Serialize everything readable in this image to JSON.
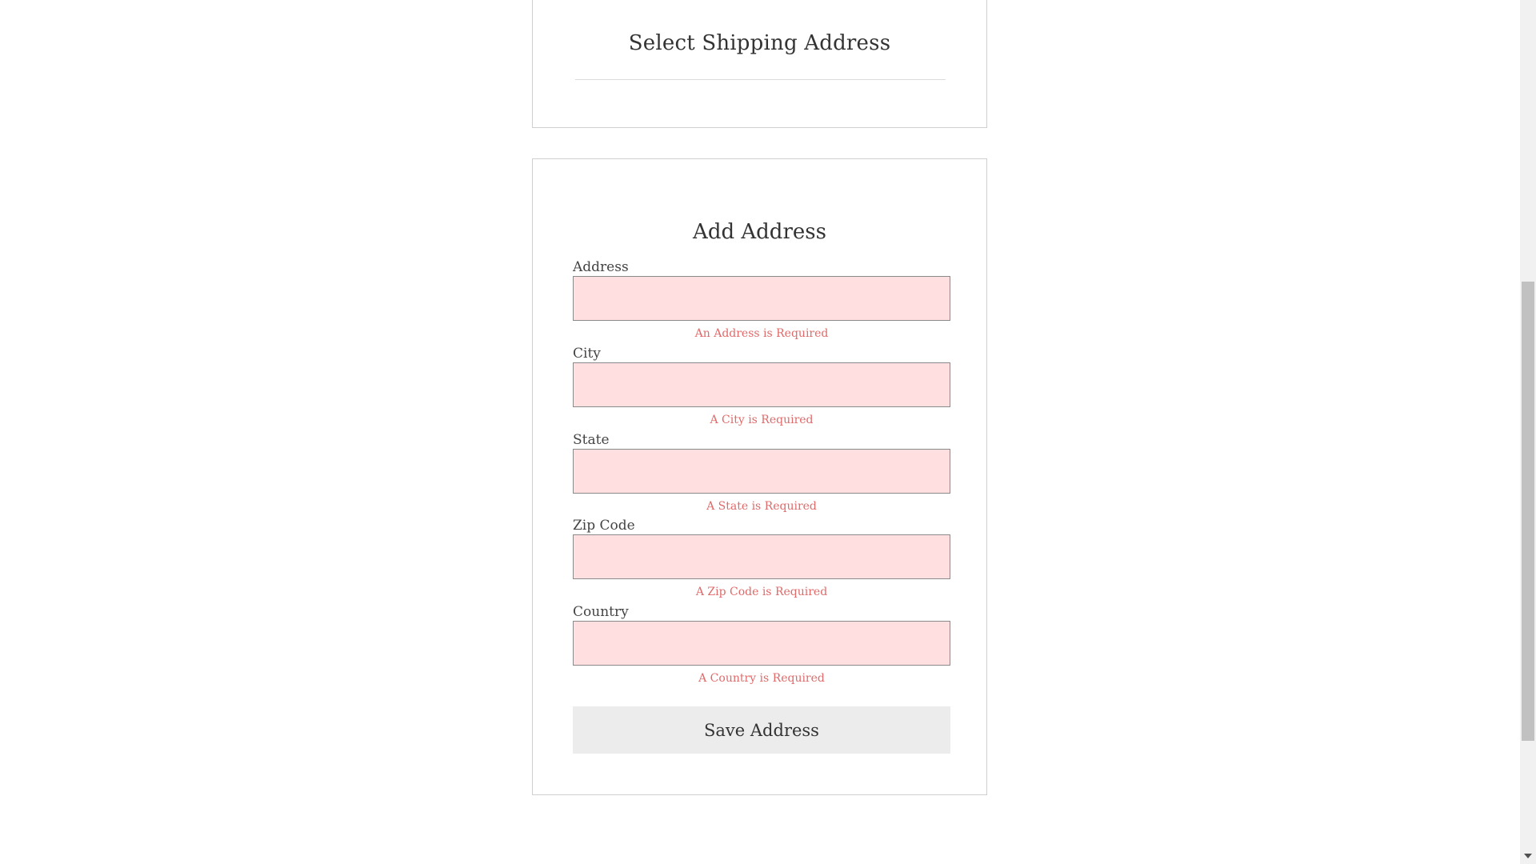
{
  "select_shipping": {
    "title": "Select Shipping Address"
  },
  "add_address": {
    "title": "Add Address",
    "fields": [
      {
        "label": "Address",
        "value": "",
        "error": "An Address is Required"
      },
      {
        "label": "City",
        "value": "",
        "error": "A City is Required"
      },
      {
        "label": "State",
        "value": "",
        "error": "A State is Required"
      },
      {
        "label": "Zip Code",
        "value": "",
        "error": "A Zip Code is Required"
      },
      {
        "label": "Country",
        "value": "",
        "error": "A Country is Required"
      }
    ],
    "save_label": "Save Address"
  },
  "colors": {
    "input_error_bg": "#ffdfe0",
    "error_text": "#e06a6a",
    "button_bg": "#ececec"
  },
  "icons": {
    "scroll_down": "chevron-down-icon"
  }
}
